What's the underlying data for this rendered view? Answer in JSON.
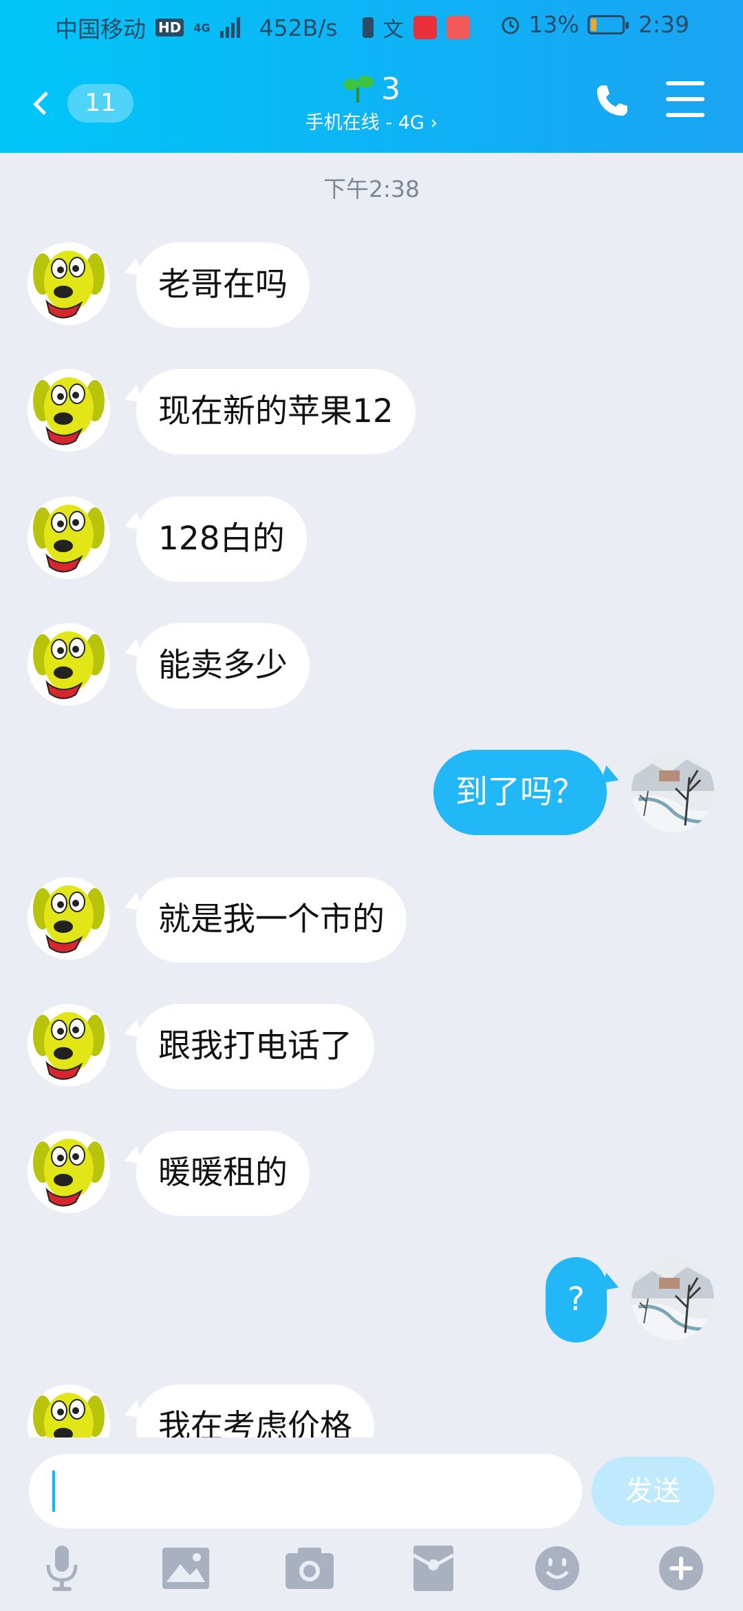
{
  "status_bar": {
    "carrier": "中国移动",
    "hd": "HD",
    "network": "4G",
    "speed": "452B/s",
    "battery": "13%",
    "time": "2:39"
  },
  "header": {
    "unread_count": "11",
    "contact_name": "3",
    "contact_status": "手机在线 - 4G",
    "status_chevron": "›"
  },
  "chat": {
    "timestamp": "下午2:38",
    "messages": [
      {
        "side": "left",
        "text": "老哥在吗"
      },
      {
        "side": "left",
        "text": "现在新的苹果12"
      },
      {
        "side": "left",
        "text": "128白的"
      },
      {
        "side": "left",
        "text": "能卖多少"
      },
      {
        "side": "right",
        "text": "到了吗？"
      },
      {
        "side": "left",
        "text": "就是我一个市的"
      },
      {
        "side": "left",
        "text": "跟我打电话了"
      },
      {
        "side": "left",
        "text": "暖暖租的"
      },
      {
        "side": "right",
        "text": "?"
      },
      {
        "side": "left",
        "text": "我在考虑价格"
      }
    ]
  },
  "composer": {
    "input_value": "",
    "send_label": "发送"
  },
  "toolbar": {
    "icons": [
      "microphone-icon",
      "image-icon",
      "camera-icon",
      "red-packet-icon",
      "emoji-icon",
      "plus-icon"
    ]
  },
  "colors": {
    "header_start": "#00c6f8",
    "header_end": "#1aa3f2",
    "outgoing_bubble": "#22b7f7",
    "incoming_bubble": "#ffffff",
    "background": "#ebedf5",
    "send_disabled": "#bfe9fc",
    "icon_gray": "#a9b1c1"
  }
}
